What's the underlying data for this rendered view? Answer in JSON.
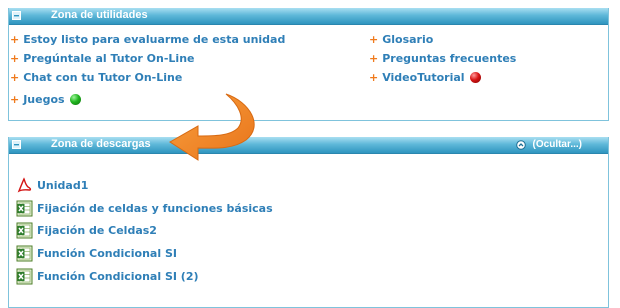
{
  "utilities": {
    "title": "Zona de utilidades",
    "left_items": [
      {
        "label": "Estoy listo para evaluarme de esta unidad"
      },
      {
        "label": "Pregúntale al Tutor On-Line"
      },
      {
        "label": "Chat con tu Tutor On-Line"
      },
      {
        "label": "Juegos"
      }
    ],
    "right_items": [
      {
        "label": "Glosario"
      },
      {
        "label": "Preguntas frecuentes"
      },
      {
        "label": "VideoTutorial"
      }
    ],
    "plus_symbol": "+"
  },
  "downloads": {
    "title": "Zona de descargas",
    "hide_label": "(Ocultar...)",
    "items": [
      {
        "label": "Unidad1",
        "icon": "pdf-icon"
      },
      {
        "label": "Fijación de celdas y funciones básicas",
        "icon": "excel-icon"
      },
      {
        "label": "Fijación de Celdas2",
        "icon": "excel-icon"
      },
      {
        "label": "Función Condicional SI",
        "icon": "excel-icon"
      },
      {
        "label": "Función Condicional SI (2)",
        "icon": "excel-icon"
      }
    ]
  },
  "colors": {
    "header_blue": "#3a9cc7",
    "link_blue": "#2f7fb7",
    "accent_orange": "#f07a1c",
    "border_blue": "#7fc3dc"
  }
}
